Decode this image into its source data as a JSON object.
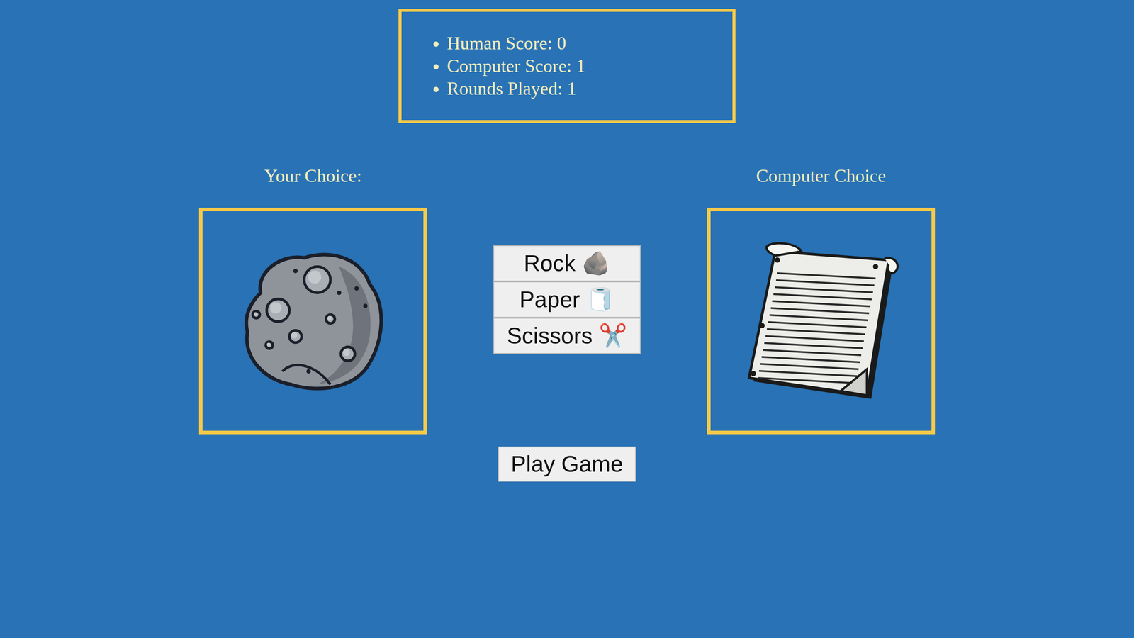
{
  "scoreboard": {
    "items": [
      "Human Score: 0",
      "Computer Score: 1",
      "Rounds Played: 1"
    ]
  },
  "choices": [
    {
      "label": "Your Choice:",
      "kind": "rock"
    },
    {
      "label": "Computer Choice",
      "kind": "paper"
    }
  ],
  "options": [
    "Rock 🪨",
    "Paper 🧻",
    "Scissors ✂️"
  ],
  "play_button": {
    "label": "Play Game"
  }
}
